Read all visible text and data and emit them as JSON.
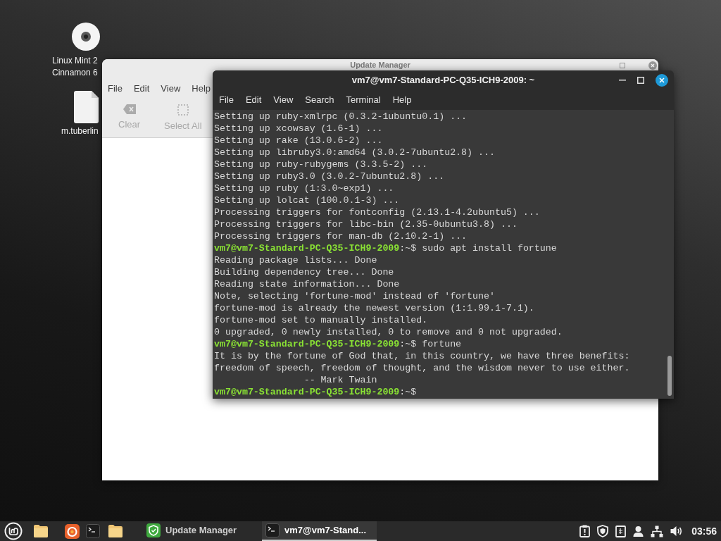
{
  "desktop_icons": [
    {
      "kind": "disc",
      "label_lines": [
        "Linux Mint 2",
        "Cinnamon 6"
      ]
    },
    {
      "kind": "file",
      "label_lines": [
        "m.tuberlin"
      ]
    }
  ],
  "update_manager": {
    "title": "Update Manager",
    "menu": [
      "File",
      "Edit",
      "View",
      "Help"
    ],
    "toolbar": [
      {
        "kind": "clear",
        "label": "Clear",
        "disabled": true
      },
      {
        "kind": "select_all",
        "label": "Select All",
        "disabled": true
      }
    ]
  },
  "terminal": {
    "title": "vm7@vm7-Standard-PC-Q35-ICH9-2009: ~",
    "menu": [
      "File",
      "Edit",
      "View",
      "Search",
      "Terminal",
      "Help"
    ],
    "lines": [
      {
        "kind": "output",
        "text": "Setting up ruby-xmlrpc (0.3.2-1ubuntu0.1) ..."
      },
      {
        "kind": "output",
        "text": "Setting up xcowsay (1.6-1) ..."
      },
      {
        "kind": "output",
        "text": "Setting up rake (13.0.6-2) ..."
      },
      {
        "kind": "output",
        "text": "Setting up libruby3.0:amd64 (3.0.2-7ubuntu2.8) ..."
      },
      {
        "kind": "output",
        "text": "Setting up ruby-rubygems (3.3.5-2) ..."
      },
      {
        "kind": "output",
        "text": "Setting up ruby3.0 (3.0.2-7ubuntu2.8) ..."
      },
      {
        "kind": "output",
        "text": "Setting up ruby (1:3.0~exp1) ..."
      },
      {
        "kind": "output",
        "text": "Setting up lolcat (100.0.1-3) ..."
      },
      {
        "kind": "output",
        "text": "Processing triggers for fontconfig (2.13.1-4.2ubuntu5) ..."
      },
      {
        "kind": "output",
        "text": "Processing triggers for libc-bin (2.35-0ubuntu3.8) ..."
      },
      {
        "kind": "output",
        "text": "Processing triggers for man-db (2.10.2-1) ..."
      },
      {
        "kind": "prompt",
        "prompt": "vm7@vm7-Standard-PC-Q35-ICH9-2009",
        "command": ":~$ sudo apt install fortune"
      },
      {
        "kind": "output",
        "text": "Reading package lists... Done"
      },
      {
        "kind": "output",
        "text": "Building dependency tree... Done"
      },
      {
        "kind": "output",
        "text": "Reading state information... Done"
      },
      {
        "kind": "output",
        "text": "Note, selecting 'fortune-mod' instead of 'fortune'"
      },
      {
        "kind": "output",
        "text": "fortune-mod is already the newest version (1:1.99.1-7.1)."
      },
      {
        "kind": "output",
        "text": "fortune-mod set to manually installed."
      },
      {
        "kind": "output",
        "text": "0 upgraded, 0 newly installed, 0 to remove and 0 not upgraded."
      },
      {
        "kind": "prompt",
        "prompt": "vm7@vm7-Standard-PC-Q35-ICH9-2009",
        "command": ":~$ fortune"
      },
      {
        "kind": "output",
        "text": "It is by the fortune of God that, in this country, we have three benefits:"
      },
      {
        "kind": "output",
        "text": "freedom of speech, freedom of thought, and the wisdom never to use either."
      },
      {
        "kind": "output",
        "text": "                -- Mark Twain"
      },
      {
        "kind": "prompt",
        "prompt": "vm7@vm7-Standard-PC-Q35-ICH9-2009",
        "command": ":~$"
      }
    ]
  },
  "taskbar": {
    "window_list": [
      {
        "kind": "update",
        "label": "Update Manager",
        "selected": false
      },
      {
        "kind": "terminal",
        "label": "vm7@vm7-Stand...",
        "selected": true
      }
    ],
    "clock": "03:56"
  }
}
